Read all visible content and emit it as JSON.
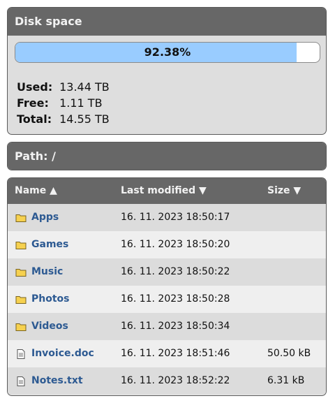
{
  "disk": {
    "title": "Disk space",
    "percent_text": "92.38%",
    "percent_value": 0.9238,
    "used_label": "Used:",
    "used_value": "13.44 TB",
    "free_label": "Free:",
    "free_value": "1.11 TB",
    "total_label": "Total:",
    "total_value": "14.55 TB"
  },
  "path": {
    "label": "Path: /"
  },
  "table": {
    "headers": {
      "name": "Name ▲",
      "modified": "Last modified ▼",
      "size": "Size ▼"
    },
    "rows": [
      {
        "icon": "folder-icon",
        "name": "Apps",
        "modified": "16. 11. 2023 18:50:17",
        "size": ""
      },
      {
        "icon": "folder-icon",
        "name": "Games",
        "modified": "16. 11. 2023 18:50:20",
        "size": ""
      },
      {
        "icon": "folder-icon",
        "name": "Music",
        "modified": "16. 11. 2023 18:50:22",
        "size": ""
      },
      {
        "icon": "folder-icon",
        "name": "Photos",
        "modified": "16. 11. 2023 18:50:28",
        "size": ""
      },
      {
        "icon": "folder-icon",
        "name": "Videos",
        "modified": "16. 11. 2023 18:50:34",
        "size": ""
      },
      {
        "icon": "file-icon",
        "name": "Invoice.doc",
        "modified": "16. 11. 2023 18:51:46",
        "size": "50.50 kB"
      },
      {
        "icon": "file-icon",
        "name": "Notes.txt",
        "modified": "16. 11. 2023 18:52:22",
        "size": "6.31 kB"
      }
    ]
  },
  "colors": {
    "panel_header": "#676767",
    "panel_body": "#dedede",
    "bar_fill": "#99ccff",
    "link": "#2d5a92",
    "folder_fill": "#f6d14f"
  }
}
